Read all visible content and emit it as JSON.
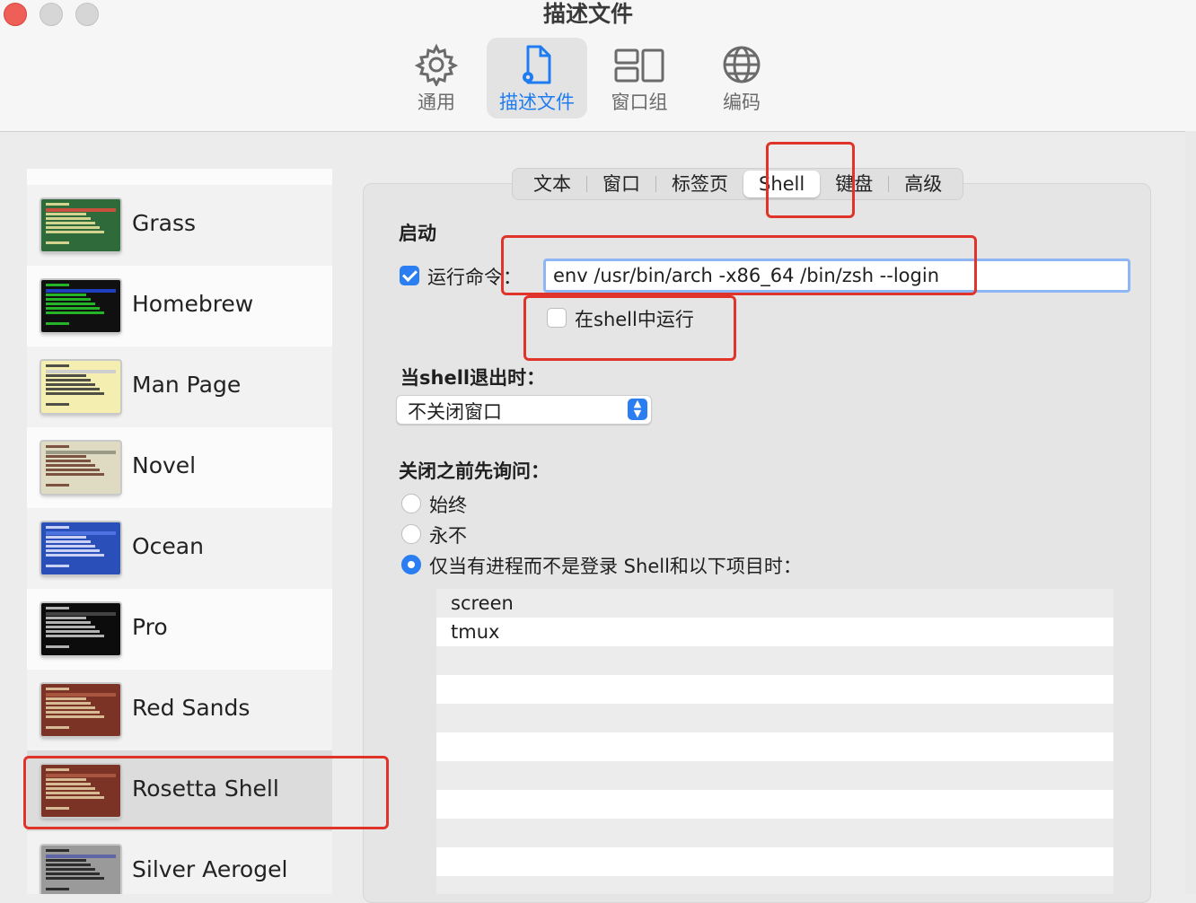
{
  "window": {
    "title": "描述文件"
  },
  "toolbar": {
    "items": [
      {
        "label": "通用",
        "icon": "gear-icon"
      },
      {
        "label": "描述文件",
        "icon": "profile-doc-icon"
      },
      {
        "label": "窗口组",
        "icon": "window-groups-icon"
      },
      {
        "label": "编码",
        "icon": "globe-icon"
      }
    ],
    "active": "描述文件"
  },
  "sidebar": {
    "profiles": [
      {
        "name": "Grass",
        "thumb_bg": "#2f6b3a",
        "thumb_fg": "#f0e6a0",
        "thumb_bar": "#c94f3e"
      },
      {
        "name": "Homebrew",
        "thumb_bg": "#101010",
        "thumb_fg": "#29d02c",
        "thumb_bar": "#1e3fbf"
      },
      {
        "name": "Man Page",
        "thumb_bg": "#f4efb0",
        "thumb_fg": "#333333",
        "thumb_bar": "#cfcfcf"
      },
      {
        "name": "Novel",
        "thumb_bg": "#dfdbc3",
        "thumb_fg": "#6b3a2a",
        "thumb_bar": "#9c9c86"
      },
      {
        "name": "Ocean",
        "thumb_bg": "#2a4fb8",
        "thumb_fg": "#e8e8ff",
        "thumb_bar": "#4d73e0"
      },
      {
        "name": "Pro",
        "thumb_bg": "#0c0c0c",
        "thumb_fg": "#d0d0d0",
        "thumb_bar": "#444444"
      },
      {
        "name": "Red Sands",
        "thumb_bg": "#7a3324",
        "thumb_fg": "#e7d4a8",
        "thumb_bar": "#a8563f"
      },
      {
        "name": "Rosetta Shell",
        "thumb_bg": "#7a3324",
        "thumb_fg": "#e7d4a8",
        "thumb_bar": "#a8563f"
      },
      {
        "name": "Silver Aerogel",
        "thumb_bg": "#9a9a9a",
        "thumb_fg": "#1a1a1a",
        "thumb_bar": "#5f66a8"
      }
    ],
    "selected": "Rosetta Shell"
  },
  "tabs": {
    "items": [
      "文本",
      "窗口",
      "标签页",
      "Shell",
      "键盘",
      "高级"
    ],
    "selected": "Shell"
  },
  "shell": {
    "startup_heading": "启动",
    "run_command_label": "运行命令：",
    "run_command_checked": true,
    "run_command_value": "env /usr/bin/arch -x86_64 /bin/zsh --login",
    "run_in_shell_label": "在shell中运行",
    "run_in_shell_checked": false,
    "on_exit_label": "当shell退出时：",
    "on_exit_value": "不关闭窗口",
    "ask_before_close_label": "关闭之前先询问：",
    "ask_options": [
      "始终",
      "永不",
      "仅当有进程而不是登录 Shell和以下项目时："
    ],
    "ask_selected_index": 2,
    "process_list": [
      "screen",
      "tmux"
    ]
  },
  "colors": {
    "accent": "#2a7ef1",
    "annotation": "#e0342a"
  }
}
